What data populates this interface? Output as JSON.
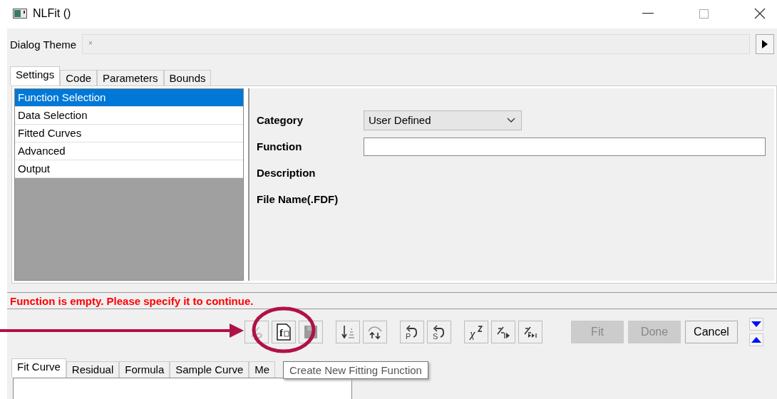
{
  "window": {
    "title": "NLFit ()"
  },
  "dialog_theme": {
    "label": "Dialog Theme",
    "value": "×"
  },
  "tabs": [
    {
      "label": "Settings",
      "selected": true
    },
    {
      "label": "Code",
      "selected": false
    },
    {
      "label": "Parameters",
      "selected": false
    },
    {
      "label": "Bounds",
      "selected": false
    }
  ],
  "function_list": [
    {
      "label": "Function Selection",
      "selected": true
    },
    {
      "label": "Data Selection",
      "selected": false
    },
    {
      "label": "Fitted Curves",
      "selected": false
    },
    {
      "label": "Advanced",
      "selected": false
    },
    {
      "label": "Output",
      "selected": false
    }
  ],
  "fields": [
    {
      "kind": "dropdown",
      "label": "Category",
      "value": "User Defined"
    },
    {
      "kind": "input",
      "label": "Function"
    },
    {
      "kind": "text",
      "label": "Description"
    },
    {
      "kind": "text",
      "label": "File Name(.FDF)"
    }
  ],
  "message": "Function is empty. Please specify it to continue.",
  "toolbar": [
    {
      "kind": "edit",
      "disabled": true
    },
    {
      "kind": "new",
      "glyph": "f",
      "disabled": false
    },
    {
      "kind": "save",
      "disabled": true
    },
    {
      "kind": "sort",
      "disabled": false
    },
    {
      "kind": "swap",
      "disabled": false
    },
    {
      "kind": "undo",
      "glyph": "P",
      "disabled": false
    },
    {
      "kind": "undo",
      "glyph": "S",
      "disabled": false
    },
    {
      "kind": "chi",
      "glyph": "χ",
      "disabled": false
    },
    {
      "kind": "step",
      "disabled": false
    },
    {
      "kind": "end",
      "disabled": false
    }
  ],
  "buttons": [
    {
      "label": "Fit",
      "disabled": true
    },
    {
      "label": "Done",
      "disabled": true
    },
    {
      "label": "Cancel",
      "disabled": false
    }
  ],
  "bottom_tabs": [
    {
      "label": "Fit Curve",
      "selected": true
    },
    {
      "label": "Residual",
      "selected": false
    },
    {
      "label": "Formula",
      "selected": false
    },
    {
      "label": "Sample Curve",
      "selected": false
    },
    {
      "label": "Me",
      "selected": false
    }
  ],
  "tooltip": "Create New Fitting Function"
}
